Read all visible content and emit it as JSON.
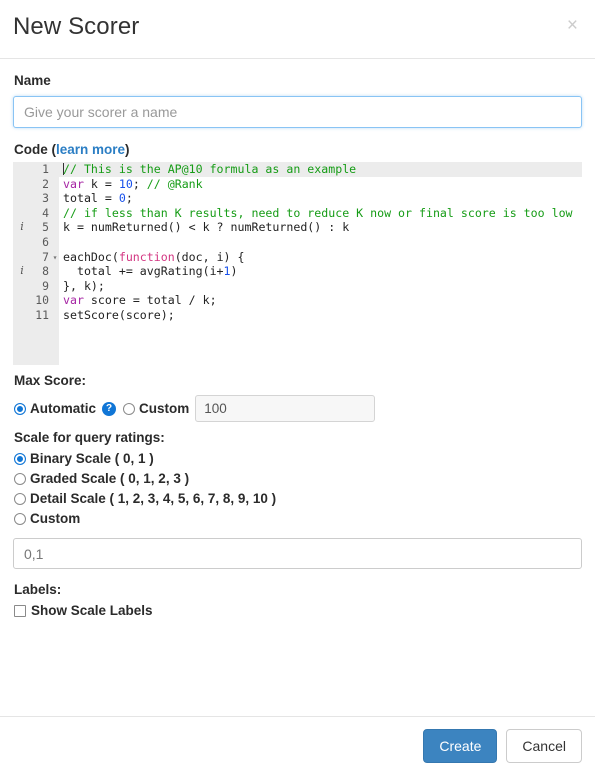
{
  "dialog": {
    "title": "New Scorer",
    "close_icon": "close-icon",
    "close_glyph": "×"
  },
  "name_field": {
    "label": "Name",
    "value": "",
    "placeholder": "Give your scorer a name",
    "focused": true
  },
  "code_section": {
    "label": "Code",
    "paren_open": "(",
    "link_text": "learn more",
    "paren_close": ")",
    "active_line": 1,
    "lines": [
      {
        "num": "1",
        "marker": "",
        "fold": "",
        "active": true,
        "tokens": [
          {
            "t": "comment",
            "s": "// This is the AP@10 formula as an example"
          }
        ]
      },
      {
        "num": "2",
        "marker": "",
        "fold": "",
        "active": false,
        "tokens": [
          {
            "t": "kw",
            "s": "var"
          },
          {
            "t": "plain",
            "s": " k = "
          },
          {
            "t": "num",
            "s": "10"
          },
          {
            "t": "plain",
            "s": "; "
          },
          {
            "t": "comment",
            "s": "// @Rank"
          }
        ]
      },
      {
        "num": "3",
        "marker": "",
        "fold": "",
        "active": false,
        "tokens": [
          {
            "t": "plain",
            "s": "total = "
          },
          {
            "t": "num",
            "s": "0"
          },
          {
            "t": "plain",
            "s": ";"
          }
        ]
      },
      {
        "num": "4",
        "marker": "",
        "fold": "",
        "active": false,
        "tokens": [
          {
            "t": "comment",
            "s": "// if less than K results, need to reduce K now or final score is too low"
          }
        ]
      },
      {
        "num": "5",
        "marker": "i",
        "fold": "",
        "active": false,
        "tokens": [
          {
            "t": "plain",
            "s": "k = numReturned() < k ? numReturned() : k"
          }
        ]
      },
      {
        "num": "6",
        "marker": "",
        "fold": "",
        "active": false,
        "tokens": [
          {
            "t": "plain",
            "s": ""
          }
        ]
      },
      {
        "num": "7",
        "marker": "",
        "fold": "▾",
        "active": false,
        "tokens": [
          {
            "t": "plain",
            "s": "eachDoc("
          },
          {
            "t": "fn",
            "s": "function"
          },
          {
            "t": "plain",
            "s": "(doc, i) {"
          }
        ]
      },
      {
        "num": "8",
        "marker": "i",
        "fold": "",
        "active": false,
        "tokens": [
          {
            "t": "plain",
            "s": "  total += avgRating(i+"
          },
          {
            "t": "num",
            "s": "1"
          },
          {
            "t": "plain",
            "s": ")"
          }
        ]
      },
      {
        "num": "9",
        "marker": "",
        "fold": "",
        "active": false,
        "tokens": [
          {
            "t": "plain",
            "s": "}, k);"
          }
        ]
      },
      {
        "num": "10",
        "marker": "",
        "fold": "",
        "active": false,
        "tokens": [
          {
            "t": "kw",
            "s": "var"
          },
          {
            "t": "plain",
            "s": " score = total / k;"
          }
        ]
      },
      {
        "num": "11",
        "marker": "",
        "fold": "",
        "active": false,
        "tokens": [
          {
            "t": "plain",
            "s": "setScore(score);"
          }
        ]
      }
    ]
  },
  "max_score": {
    "label": "Max Score:",
    "automatic_label": "Automatic",
    "custom_label": "Custom",
    "selected": "automatic",
    "help_icon": "help-circle-icon",
    "help_glyph": "?",
    "custom_value": "100",
    "custom_enabled": false
  },
  "scale": {
    "label": "Scale for query ratings:",
    "selected": "binary",
    "options": [
      {
        "id": "binary",
        "label": "Binary Scale ( 0, 1 )",
        "checked": true
      },
      {
        "id": "graded",
        "label": "Graded Scale ( 0, 1, 2, 3 )",
        "checked": false
      },
      {
        "id": "detail",
        "label": "Detail Scale ( 1, 2, 3, 4, 5, 6, 7, 8, 9, 10 )",
        "checked": false
      },
      {
        "id": "custom",
        "label": "Custom",
        "checked": false
      }
    ],
    "values_input": "0,1",
    "values_placeholder": ""
  },
  "labels_section": {
    "label": "Labels:",
    "show_scale_labels": "Show Scale Labels",
    "checked": false
  },
  "footer": {
    "create_label": "Create",
    "cancel_label": "Cancel"
  },
  "colors": {
    "primary_button": "#3c84c0",
    "radio_accent": "#1076d6",
    "link": "#2b7ec4",
    "comment_green": "#169c16",
    "keyword_purple": "#a626a4",
    "number_blue": "#1750eb",
    "function_pink": "#d33682",
    "gutter_gray": "#ececec"
  }
}
